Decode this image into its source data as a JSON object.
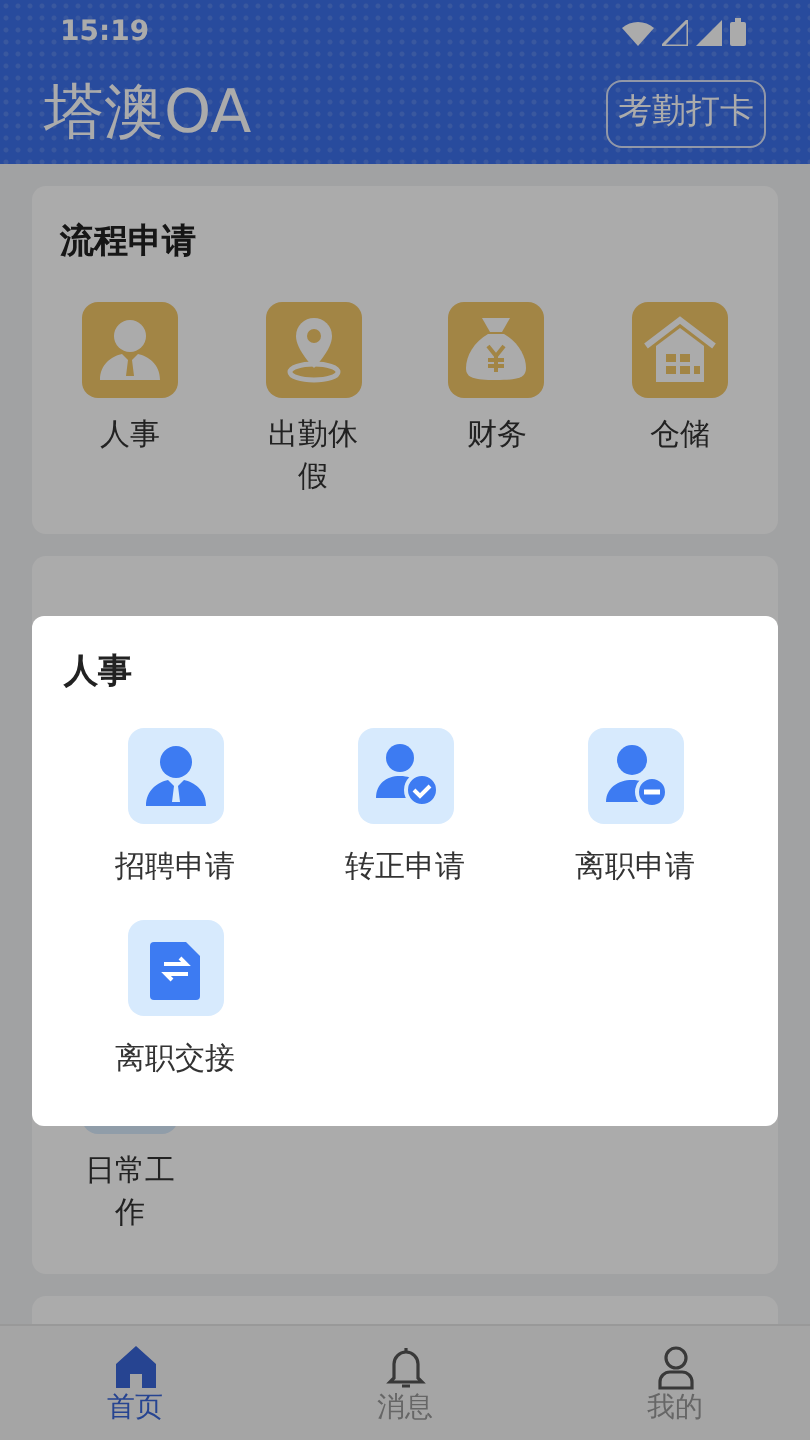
{
  "status_bar": {
    "time": "15:19"
  },
  "header": {
    "title": "塔澳OA",
    "action": "考勤打卡"
  },
  "process_section": {
    "title": "流程申请",
    "items": [
      {
        "label": "人事"
      },
      {
        "label": "出勤休假"
      },
      {
        "label": "财务"
      },
      {
        "label": "仓储"
      }
    ]
  },
  "approval_section": {
    "items": [
      {
        "label": "日常工作"
      }
    ]
  },
  "dialog": {
    "title": "人事",
    "items": [
      {
        "label": "招聘申请"
      },
      {
        "label": "转正申请"
      },
      {
        "label": "离职申请"
      },
      {
        "label": "离职交接"
      }
    ]
  },
  "tabs": [
    {
      "label": "首页",
      "selected": true
    },
    {
      "label": "消息",
      "selected": false
    },
    {
      "label": "我的",
      "selected": false
    }
  ]
}
